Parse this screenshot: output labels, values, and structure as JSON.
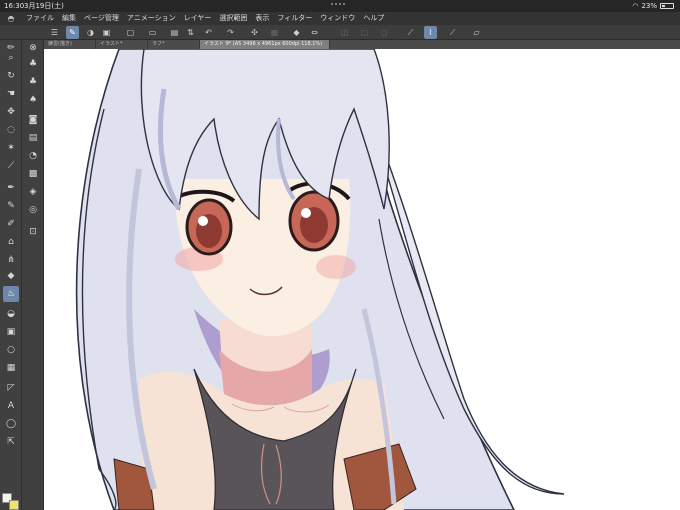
{
  "status_bar": {
    "time": "16:30",
    "date": "3月19日(土)",
    "battery": "23%"
  },
  "menu": {
    "items": [
      "ファイル",
      "編集",
      "ページ管理",
      "アニメーション",
      "レイヤー",
      "選択範囲",
      "表示",
      "フィルター",
      "ウィンドウ",
      "ヘルプ"
    ]
  },
  "tabs": [
    {
      "label": "練習(描き)"
    },
    {
      "label": "イラスト*"
    },
    {
      "label": "ラフ*"
    },
    {
      "label": "イラスト 9* (A5 3496 x 4961px 600dpi 118.1%)"
    }
  ],
  "colors": {
    "main": "#f7f4ea",
    "sub": "#f4e36b",
    "accent": "#6d88a8"
  },
  "icons": {
    "toolbar": [
      "menu-icon",
      "pen-pressure-icon",
      "settings-icon",
      "new-file-icon",
      "open-folder-icon",
      "save-icon",
      "print-icon",
      "undo-icon",
      "redo-icon",
      "clear-icon",
      "fill-icon",
      "transform-icon",
      "flip-icon",
      "rotate-icon",
      "pen-icon",
      "vector-icon",
      "stabilizer-icon",
      "ruler-icon"
    ],
    "tools_col1": [
      "brush-size-icon",
      "zoom-icon",
      "rotate-view-icon",
      "hand-icon",
      "move-icon",
      "lasso-icon",
      "wand-icon",
      "eyedropper-icon",
      "pen-tool-icon",
      "pencil-icon",
      "marker-icon",
      "brush-icon",
      "airbrush-icon",
      "eraser-icon",
      "blend-icon",
      "fill-tool-icon",
      "gradient-icon",
      "figure-icon",
      "frame-icon",
      "ruler-tool-icon",
      "text-icon",
      "balloon-icon",
      "correct-line-icon"
    ]
  }
}
